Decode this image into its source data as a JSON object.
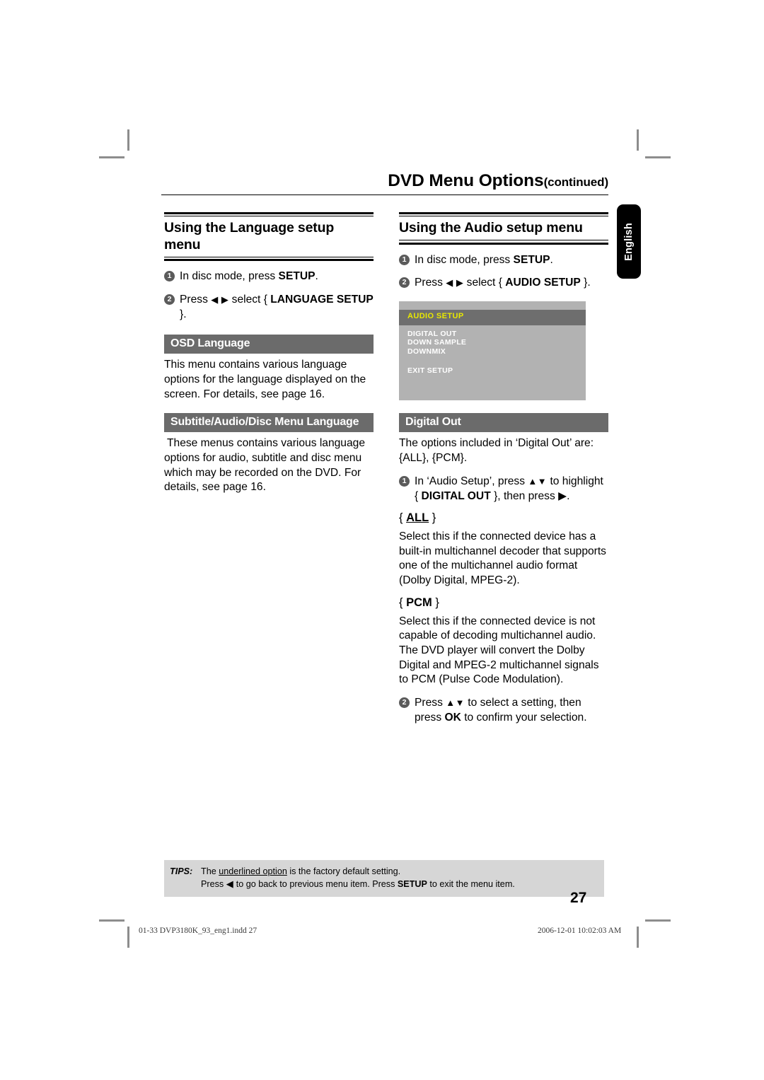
{
  "running_head": {
    "title": "DVD Menu Options",
    "continued": "(continued)"
  },
  "side_tab": {
    "label": "English"
  },
  "left_column": {
    "heading": "Using the Language setup menu",
    "steps": [
      {
        "num": "1",
        "pre": "In disc mode, press ",
        "bold": "SETUP",
        "post": "."
      },
      {
        "num": "2",
        "pre": "Press ",
        "arrows": "◀ ▶",
        "mid": " select { ",
        "bold": "LANGUAGE SETUP",
        "post": " }."
      }
    ],
    "sections": [
      {
        "bar": "OSD Language",
        "body": "This menu contains various language options for the language displayed on the screen. For details, see page 16."
      },
      {
        "bar": "Subtitle/Audio/Disc Menu Language",
        "body": "These menus contains various language options for audio, subtitle and disc menu which may be recorded on the DVD. For details, see page 16."
      }
    ]
  },
  "right_column": {
    "heading": "Using the Audio setup menu",
    "steps": [
      {
        "num": "1",
        "pre": "In disc mode, press ",
        "bold": "SETUP",
        "post": "."
      },
      {
        "num": "2",
        "pre": "Press ",
        "arrows": "◀ ▶",
        "mid": " select { ",
        "bold": "AUDIO SETUP",
        "post": " }."
      }
    ],
    "osd_screen": {
      "title": "AUDIO  SETUP",
      "items": [
        "DIGITAL OUT",
        "DOWN SAMPLE",
        "DOWNMIX"
      ],
      "exit": "EXIT SETUP",
      "colors": {
        "panel_bg": "#b2b2b2",
        "titlebar_bg": "#6e6e6e",
        "title_text": "#e8e800",
        "item_text": "#ffffff"
      }
    },
    "section": {
      "bar": "Digital Out",
      "intro": "The options included in ‘Digital Out’ are: {ALL}, {PCM}.",
      "step1": {
        "num": "1",
        "pre": "In ‘Audio Setup’, press ",
        "arrows": "▲▼",
        "mid": " to highlight { ",
        "bold": "DIGITAL OUT",
        "post": " }, then press ▶."
      },
      "options": [
        {
          "label_open": "{ ",
          "label": "ALL",
          "label_close": " }",
          "underlined": true,
          "body": "Select this if the connected device has a built-in multichannel decoder that supports one of the multichannel audio format (Dolby Digital, MPEG-2)."
        },
        {
          "label_open": "{ ",
          "label": "PCM",
          "label_close": " }",
          "underlined": false,
          "body": "Select this if the connected device is not capable of decoding multichannel audio. The DVD player will convert the Dolby Digital and MPEG-2 multichannel signals to PCM (Pulse Code Modulation)."
        }
      ],
      "step2": {
        "num": "2",
        "pre": "Press ",
        "arrows": "▲▼",
        "mid": " to select a setting, then press ",
        "bold": "OK",
        "post": " to confirm your selection."
      }
    }
  },
  "tips": {
    "label": "TIPS:",
    "line1_pre": "The ",
    "line1_underlined": "underlined option",
    "line1_post": " is the factory default setting.",
    "line2_pre": "Press ",
    "line2_arrow": "◀",
    "line2_mid": " to go back to previous menu item. Press ",
    "line2_bold": "SETUP",
    "line2_post": " to exit the menu item."
  },
  "page_number": "27",
  "print_footer": {
    "left": "01-33 DVP3180K_93_eng1.indd   27",
    "right": "2006-12-01   10:02:03 AM"
  }
}
